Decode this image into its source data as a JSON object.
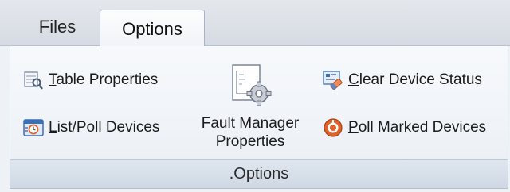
{
  "tabs": {
    "files": "Files",
    "options": "Options"
  },
  "commands": {
    "table_properties": {
      "first": "T",
      "rest": "able Properties",
      "icon": "table-properties-icon"
    },
    "list_poll_devices": {
      "first": "L",
      "rest": "ist/Poll Devices",
      "icon": "list-poll-devices-icon"
    },
    "fault_manager": {
      "line1": "Fault Manager",
      "line2": "Properties",
      "icon": "fault-manager-properties-icon"
    },
    "clear_device_status": {
      "first": "C",
      "rest": "lear Device Status",
      "icon": "clear-device-status-icon"
    },
    "poll_marked_devices": {
      "first": "P",
      "rest": "oll Marked Devices",
      "icon": "poll-marked-devices-icon"
    }
  },
  "group": {
    "label": ".Options"
  },
  "colors": {
    "accent": "#3b6fb5",
    "poll_orange": "#e0622b"
  }
}
